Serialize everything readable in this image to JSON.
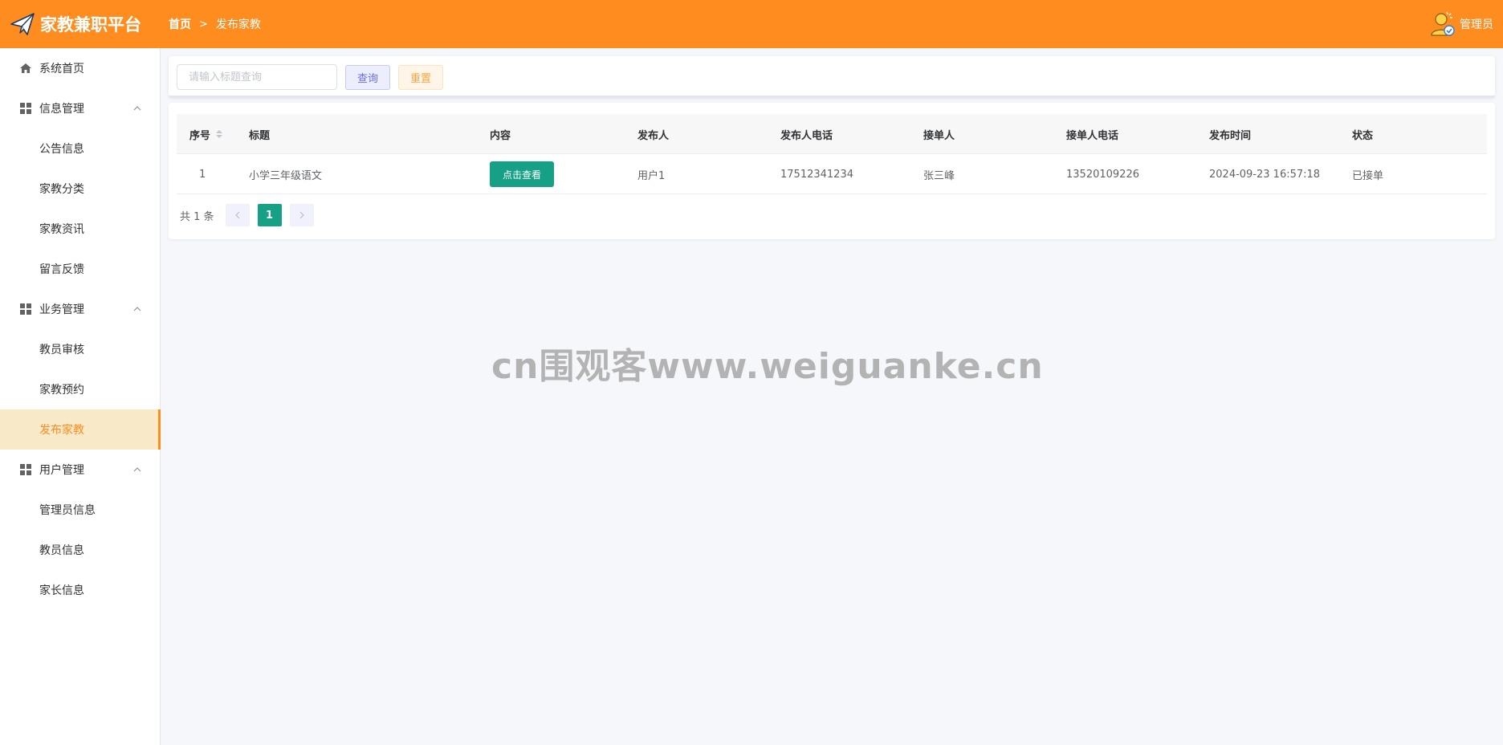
{
  "header": {
    "brand_title": "家教兼职平台",
    "breadcrumb": {
      "home": "首页",
      "current": "发布家教"
    },
    "user_label": "管理员",
    "accent_color": "#ff8c1f"
  },
  "sidebar": {
    "items": [
      {
        "label": "系统首页",
        "icon": "home-icon"
      },
      {
        "label": "信息管理",
        "icon": "grid-icon"
      },
      {
        "label": "公告信息"
      },
      {
        "label": "家教分类"
      },
      {
        "label": "家教资讯"
      },
      {
        "label": "留言反馈"
      },
      {
        "label": "业务管理",
        "icon": "grid-icon"
      },
      {
        "label": "教员审核"
      },
      {
        "label": "家教预约"
      },
      {
        "label": "发布家教",
        "active": true
      },
      {
        "label": "用户管理",
        "icon": "grid-icon"
      },
      {
        "label": "管理员信息"
      },
      {
        "label": "教员信息"
      },
      {
        "label": "家长信息"
      }
    ]
  },
  "search": {
    "placeholder": "请输入标题查询",
    "value": "",
    "query_label": "查询",
    "reset_label": "重置"
  },
  "table": {
    "headers": [
      "序号",
      "标题",
      "内容",
      "发布人",
      "发布人电话",
      "接单人",
      "接单人电话",
      "发布时间",
      "状态"
    ],
    "rows": [
      {
        "index": "1",
        "title": "小学三年级语文",
        "content_button": "点击查看",
        "publisher": "用户1",
        "publisher_phone": "17512341234",
        "taker": "张三峰",
        "taker_phone": "13520109226",
        "publish_time": "2024-09-23 16:57:18",
        "status": "已接单"
      }
    ]
  },
  "pagination": {
    "total_text": "共 1 条",
    "current_page": "1"
  },
  "watermark": "cn围观客www.weiguanke.cn"
}
